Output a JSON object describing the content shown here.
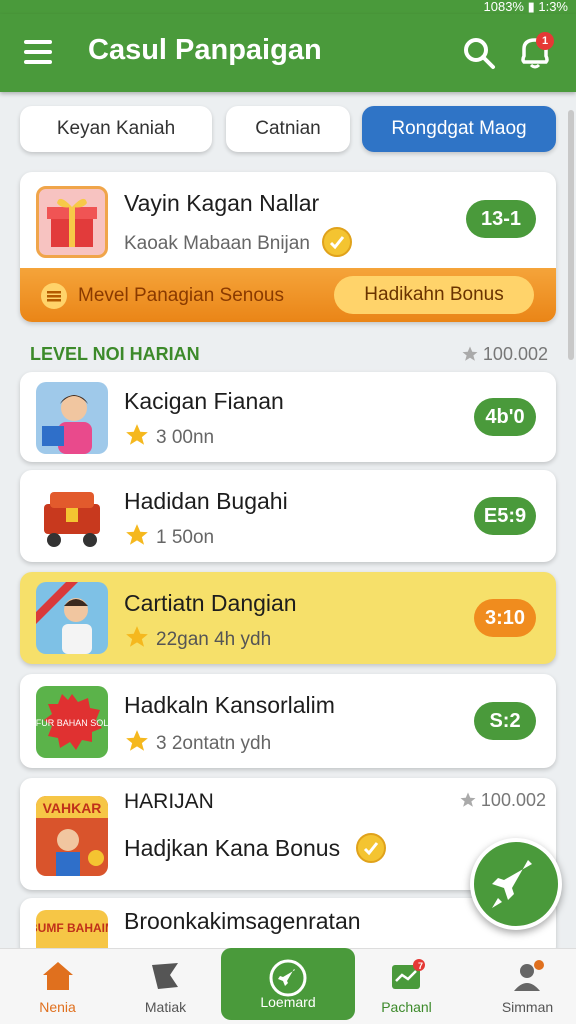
{
  "status": {
    "battery": "1083% ▮ 1:3%"
  },
  "header": {
    "title": "Casul Panpaigan",
    "notif_count": "1"
  },
  "filters": [
    "Keyan Kaniah",
    "Catnian",
    "Rongdgat Maog"
  ],
  "featured": {
    "title": "Vayin Kagan Nallar",
    "subtitle": "Kaoak Mabaan Bnijan",
    "pill": "13-1"
  },
  "banner": {
    "left": "Mevel Panagian Senous",
    "button": "Hadikahn Bonus"
  },
  "section1": {
    "label": "LEVEL NOI HARIAN",
    "count": "100.002"
  },
  "items": [
    {
      "title": "Kacigan Fianan",
      "sub": "3 00nn",
      "pill": "4b'0"
    },
    {
      "title": "Hadidan Bugahi",
      "sub": "1 50on",
      "pill": "E5:9"
    },
    {
      "title": "Cartiatn Dangian",
      "sub": "22gan 4h ydh",
      "pill": "3:10"
    },
    {
      "title": "Hadkaln Kansorlalim",
      "sub": "3 2ontatn ydh",
      "pill": "S:2"
    }
  ],
  "section2": {
    "label": "HARIJAN",
    "count": "100.002",
    "title": "Hadjkan Kana Bonus"
  },
  "partial_item": {
    "title": "Broonkakimsagenratan"
  },
  "thumb_text": {
    "sale": "NAFUR BAHAN SOLDA",
    "varn": "VAHKAR",
    "bumf": "BUMF BAHAIM"
  },
  "nav": [
    "Nenia",
    "Matiak",
    "Loemard",
    "Pachanl",
    "Simman"
  ],
  "nav_badge": "7",
  "colors": {
    "green": "#4a9a3b",
    "blue": "#2f74c6",
    "orange": "#f08c1e",
    "yellow_highlight": "#f6e06a"
  }
}
